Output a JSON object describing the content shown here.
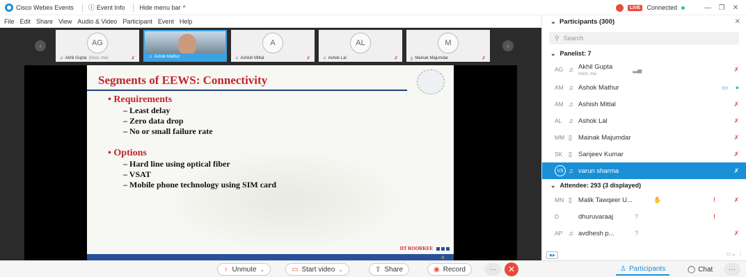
{
  "titlebar": {
    "app_name": "Cisco Webex Events",
    "event_info": "Event Info",
    "hide_menu": "Hide menu bar",
    "live": "LIVE",
    "connected": "Connected"
  },
  "menubar": {
    "items": [
      "File",
      "Edit",
      "Share",
      "View",
      "Audio & Video",
      "Participant",
      "Event",
      "Help"
    ]
  },
  "filmstrip": {
    "tiles": [
      {
        "initials": "AG",
        "name": "Akhil Gupta",
        "sub": "(Host, me)"
      },
      {
        "initials": "",
        "name": "Ashok Mathur",
        "sub": ""
      },
      {
        "initials": "A",
        "name": "Ashish Mittal",
        "sub": ""
      },
      {
        "initials": "AL",
        "name": "Ashok Lal",
        "sub": ""
      },
      {
        "initials": "M",
        "name": "Mainak Majumdar",
        "sub": ""
      }
    ]
  },
  "slide": {
    "title": "Segments of EEWS: Connectivity",
    "bullets": [
      {
        "heading": "Requirements",
        "items": [
          "Least delay",
          "Zero data drop",
          "No or small failure rate"
        ]
      },
      {
        "heading": "Options",
        "items": [
          "Hard line using optical fiber",
          "VSAT",
          "Mobile phone technology using SIM card"
        ]
      }
    ],
    "footer": "IIT ROORKEE",
    "page": "8"
  },
  "panel": {
    "title": "Participants (300)",
    "search_placeholder": "Search",
    "panelist_group": "Panelist: 7",
    "panelists": [
      {
        "initials": "AG",
        "name": "Akhil Gupta",
        "sub": "Host, me"
      },
      {
        "initials": "AM",
        "name": "Ashok Mathur",
        "sub": ""
      },
      {
        "initials": "AM",
        "name": "Ashish Mittal",
        "sub": ""
      },
      {
        "initials": "AL",
        "name": "Ashok Lal",
        "sub": ""
      },
      {
        "initials": "MM",
        "name": "Mainak Majumdar",
        "sub": ""
      },
      {
        "initials": "SK",
        "name": "Sanjeev Kumar",
        "sub": ""
      },
      {
        "initials": "VS",
        "name": "varun sharma",
        "sub": ""
      }
    ],
    "attendee_group": "Attendee: 293 (3 displayed)",
    "attendees": [
      {
        "initials": "MN",
        "name": "Malik Tawqeer U...",
        "extra": "!"
      },
      {
        "initials": "D",
        "name": "dhuruvaraaj",
        "extra": "?"
      },
      {
        "initials": "AP",
        "name": "avdhesh p...",
        "extra": "?"
      }
    ]
  },
  "controls": {
    "unmute": "Unmute",
    "start_video": "Start video",
    "share": "Share",
    "record": "Record",
    "participants": "Participants",
    "chat": "Chat"
  },
  "colors": {
    "accent": "#1a8fd8",
    "danger": "#e74c3c",
    "slide_title": "#c0262d",
    "slide_blue": "#2a4f9a"
  }
}
